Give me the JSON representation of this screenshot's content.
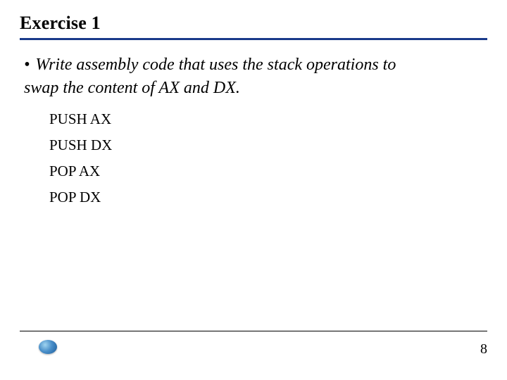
{
  "title": "Exercise 1",
  "bullet_char": "•",
  "question_line1": "Write assembly code that uses the stack operations to",
  "question_line2": "swap the content of AX and DX.",
  "code": {
    "line1": "PUSH AX",
    "line2": "PUSH DX",
    "line3": "POP AX",
    "line4": "POP DX"
  },
  "page_number": "8"
}
